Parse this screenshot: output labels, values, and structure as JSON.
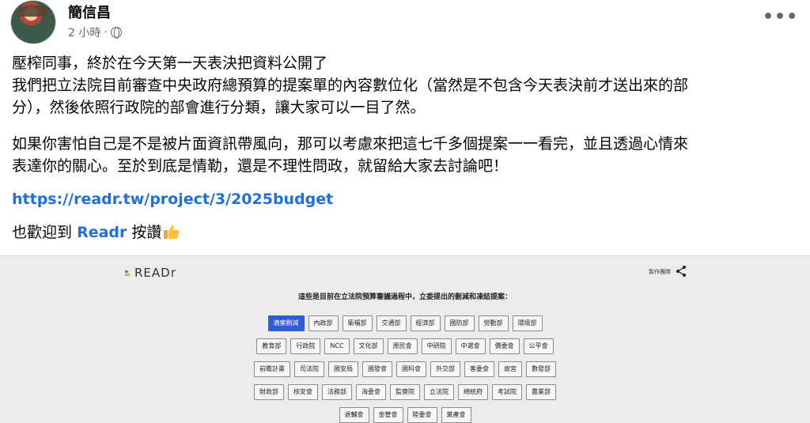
{
  "post": {
    "author": "簡信昌",
    "time": "2 小時",
    "separator": "·",
    "more_label": "•••",
    "lines": {
      "l1": "壓榨同事，終於在今天第一天表決把資料公開了",
      "l2": "我們把立法院目前審查中央政府總預算的提案單的內容數位化（當然是不包含今天表決前才送出來的部",
      "l3": "分），然後依照行政院的部會進行分類，讓大家可以一目了然。",
      "l4": "如果你害怕自己是不是被片面資訊帶風向，那可以考慮來把這七千多個提案一一看完，並且透過心情來",
      "l5": "表達你的關心。至於到底是情勒，還是不理性問政，就留給大家去討論吧！"
    },
    "link": "https://readr.tw/project/3/2025budget",
    "welcome_prefix": "也歡迎到",
    "welcome_brand": "Readr",
    "welcome_suffix": "按讚",
    "icons": {
      "globe": "globe-icon",
      "thumb": "thumbs-up-icon",
      "more": "more-options-icon"
    }
  },
  "preview": {
    "logo": "READr",
    "credits": "製作團隊",
    "heading": "這些是目前在立法院預算審議過程中，立委提出的刪減和凍結提案：",
    "rows": [
      [
        "適案刪減",
        "內政部",
        "衛福部",
        "交通部",
        "經濟部",
        "國防部",
        "勞動部",
        "環境部"
      ],
      [
        "教育部",
        "行政院",
        "NCC",
        "文化部",
        "原民會",
        "中研院",
        "中選會",
        "僑委會",
        "公平會"
      ],
      [
        "前瞻計畫",
        "司法院",
        "國安局",
        "國發會",
        "國科會",
        "外交部",
        "客委會",
        "故宮",
        "數發部"
      ],
      [
        "財政部",
        "核安會",
        "法務部",
        "海委會",
        "監察院",
        "立法院",
        "總統府",
        "考試院",
        "農業部"
      ],
      [
        "退輔會",
        "金管會",
        "陸委會",
        "黨產會"
      ]
    ],
    "active_tag": "適案刪減",
    "colors": {
      "active": "#2e5bd8",
      "link": "#216fdb"
    }
  }
}
